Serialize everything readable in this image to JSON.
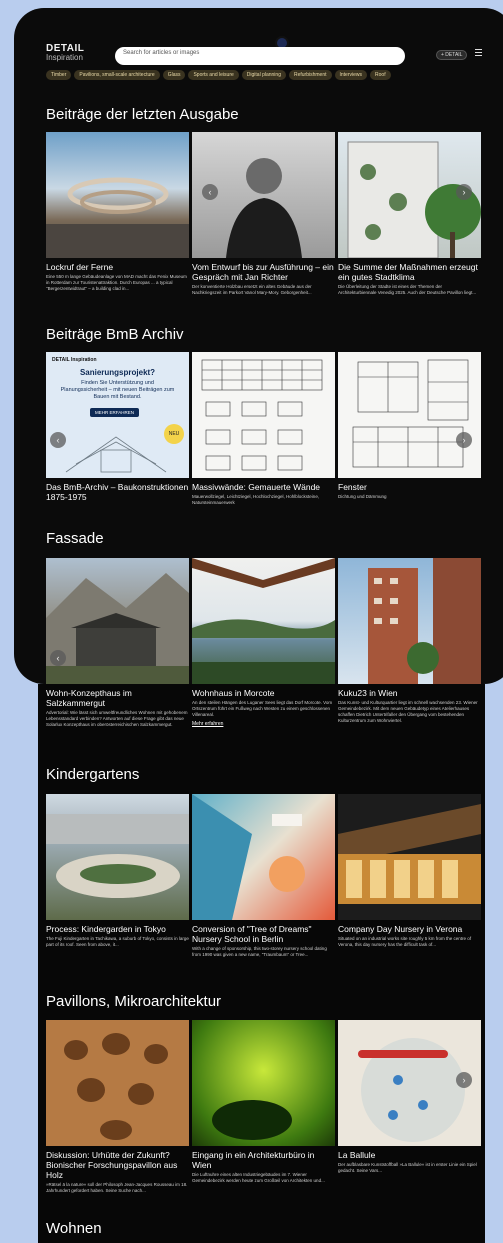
{
  "header": {
    "logo_line1": "DETAIL",
    "logo_line2": "Inspiration",
    "search_placeholder": "Search for articles or images",
    "plus_label": "+ DETAIL"
  },
  "tags": [
    "Timber",
    "Pavilions, small-scale architecture",
    "Glass",
    "Sports and leisure",
    "Digital planning",
    "Refurbishment",
    "Interviews",
    "Roof"
  ],
  "sections": [
    {
      "title": "Beiträge der letzten Ausgabe",
      "cards": [
        {
          "title": "Lockruf der Ferne",
          "text": "Eine 550 m lange Gebäudeanlage von MAD macht das Fenix Museum in Rotterdam zur Touristenattraktion. Durch Europas ... a typical \"Bergerzentwidtraut\" – a building clad in..."
        },
        {
          "title": "Vom Entwurf bis zur Ausführung – ein Gespräch mit Jan Richter",
          "text": "Der konventierte Holzbau ersetzt ein altes Gebäude aus der Nachkriegszeit im Parkort Vanol Mary-Mory. Geborgenheit..."
        },
        {
          "title": "Die Summe der Maßnahmen erzeugt ein gutes Stadtklima",
          "text": "Die Überleitung der Stadte ist eines der Themen der Architekturbiennale Venedig 2025. Auch der Deutsche Pavillon liegt..."
        }
      ]
    },
    {
      "title": "Beiträge BmB Archiv",
      "cards": [
        {
          "title": "Das BmB-Archiv – Baukonstruktionen 1875-1975",
          "text": ""
        },
        {
          "title": "Massivwände: Gemauerte Wände",
          "text": "Mauerwollziegel, Leichtziegel, Hochlochziegel, Hohlblocksteine, Naturstein­mauerwerk"
        },
        {
          "title": "Fenster",
          "text": "Dichtung und Dämmung"
        }
      ]
    },
    {
      "title": "Fassade",
      "cards": [
        {
          "title": "Wohn-Konzepthaus im Salzkammergut",
          "text": "Advertorial: Wie lässt sich umweltfreundliches Wohnen mit gehobenem Lebensstandard verbinden? Antworten auf diese Frage gibt das neue Solarlux Konzepthaus im oberösterreichischen Salzkammergut."
        },
        {
          "title": "Wohnhaus in Morcote",
          "text": "An den steilen Hängen des Luganer Sees liegt das Dorf Morcote. Vom Ortszentrum führt ein Fußweg nach Westen zu einem geschlossenen Villenareal.",
          "more": "Mehr erfahren"
        },
        {
          "title": "Kuku23 in Wien",
          "text": "Das Kunst- und Kulturquartier liegt im schnell wachsenden 23. Wiener Gemeindebezirk. Mit dem neuen Gebäudetyp eines Atelierhauses schaffen Dietrich Untertrifaller den Übergang vom bestehenden Kulturzentrum zum Wohnviertel."
        }
      ]
    },
    {
      "title": "Kindergartens",
      "cards": [
        {
          "title": "Process: Kindergarden in Tokyo",
          "text": "The Fuji Kindergarten in Tachikawa, a suburb of Tokyo, consists in large part of its roof. Seen from above, it..."
        },
        {
          "title": "Conversion of \"Tree of Dreams\" Nursery School in Berlin",
          "text": "With a change of sponsorship, this two-storey nursery school dating from 1990 was given a new name, \"Traumbaum\" or Tree..."
        },
        {
          "title": "Company Day Nursery in Verona",
          "text": "Situated on an industrial works site roughly 5 km from the centre of Verona, this day nursery has the difficult task of..."
        }
      ]
    },
    {
      "title": "Pavillons, Mikroarchitektur",
      "cards": [
        {
          "title": "Diskussion: Urhütte der Zukunft? Bionischer Forschungspavillon aus Holz",
          "text": "»Rätsel ä la nature« soll der Philosoph Jean-Jacques Rousseau im 18. Jahrhundert gefordert haben. Seine Suche nach..."
        },
        {
          "title": "Eingang in ein Architekturbüro in Wien",
          "text": "Die Luftnuhre eines alten Industriegebäudes im 7. Wiener Gemeindebezirk werden heute zum Großteil von Architekten und..."
        },
        {
          "title": "La Ballule",
          "text": "Der aufblasbare Kunststoffball »La Ballule« ist in erster Linie ein Spiel gedacht. Seine Vars..."
        }
      ]
    },
    {
      "title": "Wohnen",
      "cards": []
    }
  ],
  "flyer": {
    "logo": "DETAIL Inspiration",
    "headline": "Sanierungsprojekt?",
    "body": "Finden Sie Unterstützung und Planungssicherheit – mit neuen Beiträgen zum Bauen mit Bestand.",
    "button": "MEHR ERFAHREN",
    "badge": "NEU"
  },
  "colors": {
    "page_bg": "#070707",
    "outer_bg": "#b9cdee",
    "tag_bg": "#3a3320",
    "tag_text": "#e8d9a8"
  }
}
